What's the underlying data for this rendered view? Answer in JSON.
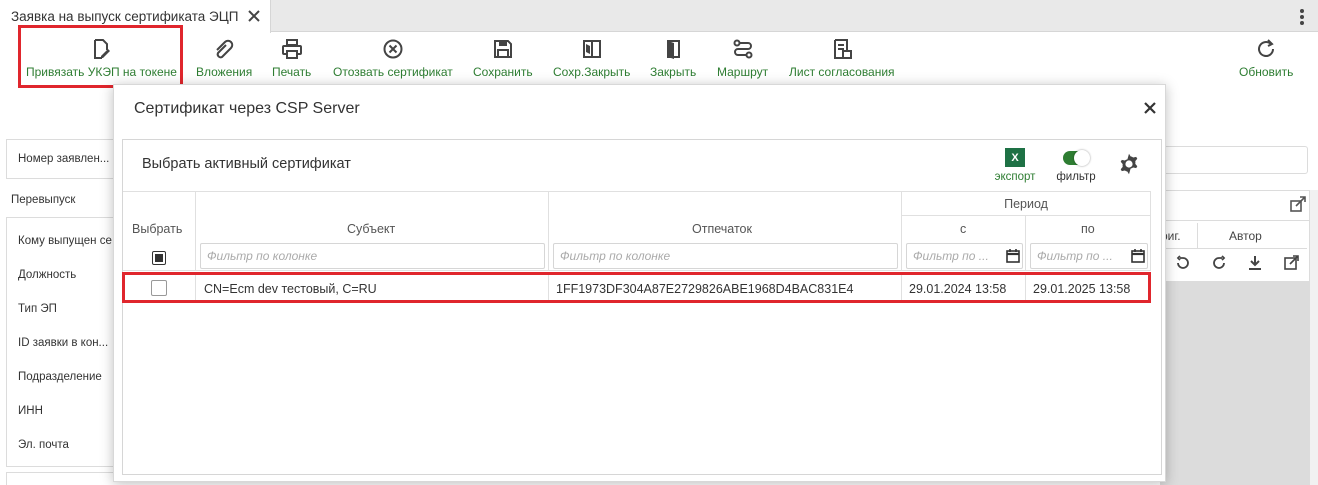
{
  "tab": {
    "title": "Заявка на выпуск сертификата ЭЦП"
  },
  "toolbar": {
    "bind_token": "Привязать УКЭП на токене",
    "attachments": "Вложения",
    "print": "Печать",
    "revoke": "Отозвать сертификат",
    "save": "Сохранить",
    "save_close": "Сохр.Закрыть",
    "close": "Закрыть",
    "route": "Маршрут",
    "approval_sheet": "Лист согласования",
    "refresh": "Обновить"
  },
  "background_form": {
    "request_number": "Номер заявлен...",
    "reissue": "Перевыпуск",
    "issued_to": "Кому выпущен се",
    "position": "Должность",
    "sig_type": "Тип ЭП",
    "request_id": "ID заявки в кон...",
    "department": "Подразделение",
    "inn": "ИНН",
    "email": "Эл. почта",
    "col_orig": "риг.",
    "col_author": "Автор"
  },
  "modal": {
    "title": "Сертификат через CSP Server",
    "inner_title": "Выбрать активный сертификат",
    "export_label": "экспорт",
    "filter_label": "фильтр",
    "excel_glyph": "X",
    "filter_enabled": true
  },
  "grid": {
    "columns": {
      "select": "Выбрать",
      "subject": "Субъект",
      "thumbprint": "Отпечаток",
      "period": "Период",
      "from": "с",
      "to": "по"
    },
    "filter_placeholder": "Фильтр по колонке",
    "date_filter_placeholder": "Фильтр по ...",
    "rows": [
      {
        "selected": false,
        "subject": "CN=Ecm dev тестовый, C=RU",
        "thumbprint": "1FF1973DF304A87E2729826ABE1968D4BAC831E4",
        "from": "29.01.2024 13:58",
        "to": "29.01.2025 13:58"
      }
    ]
  },
  "colors": {
    "accent_green": "#2e7d32",
    "highlight_red": "#e0262d",
    "excel_green": "#1e7145"
  }
}
